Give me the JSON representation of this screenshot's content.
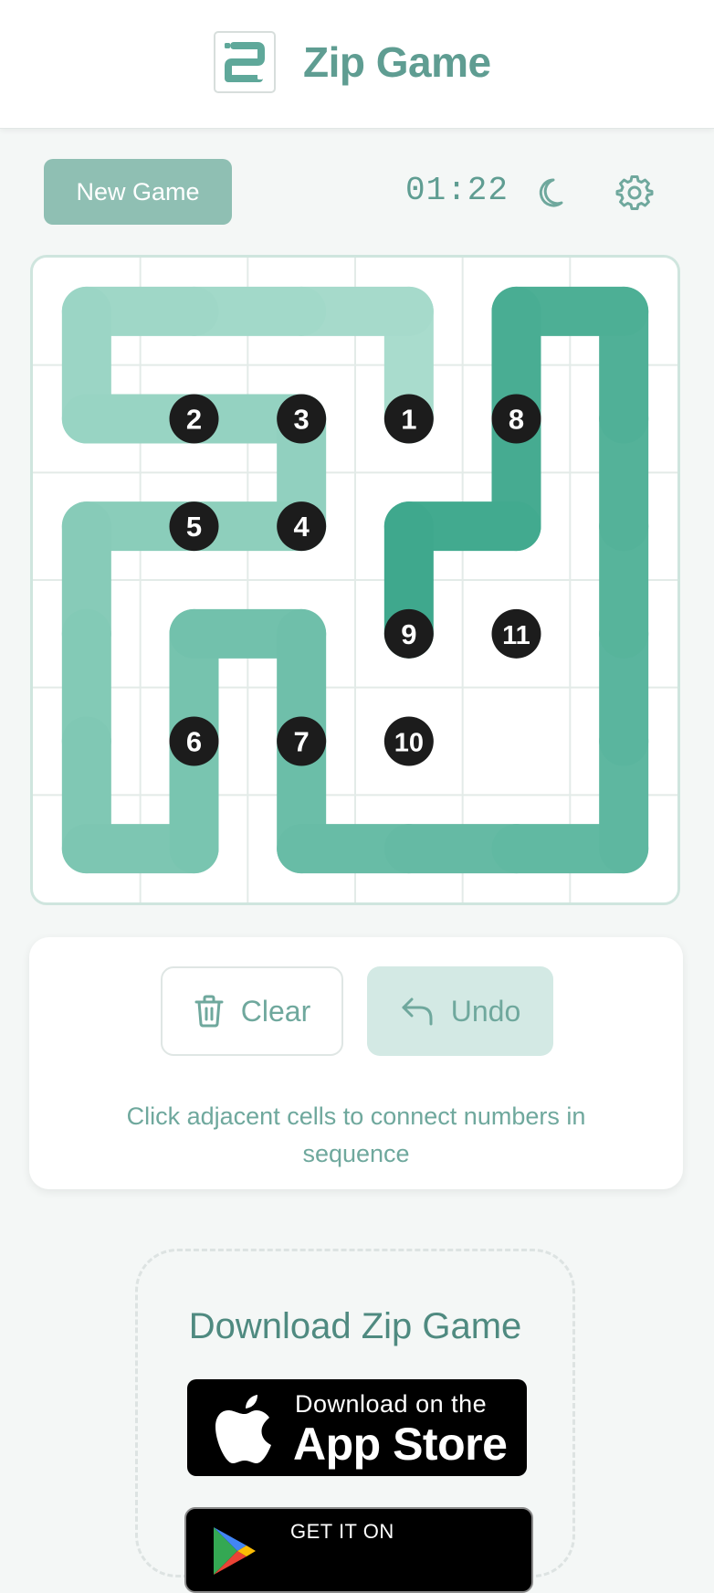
{
  "header": {
    "title": "Zip Game",
    "logo_icon": "zip-logo-icon"
  },
  "toolbar": {
    "new_game_label": "New Game",
    "timer": "01:22",
    "theme_icon": "moon-icon",
    "settings_icon": "gear-icon"
  },
  "board": {
    "rows": 6,
    "cols": 6,
    "numbers": [
      {
        "label": "1",
        "row": 1,
        "col": 3
      },
      {
        "label": "2",
        "row": 1,
        "col": 1
      },
      {
        "label": "3",
        "row": 1,
        "col": 2
      },
      {
        "label": "4",
        "row": 2,
        "col": 2
      },
      {
        "label": "5",
        "row": 2,
        "col": 1
      },
      {
        "label": "6",
        "row": 4,
        "col": 1
      },
      {
        "label": "7",
        "row": 4,
        "col": 2
      },
      {
        "label": "8",
        "row": 1,
        "col": 4
      },
      {
        "label": "9",
        "row": 3,
        "col": 3
      },
      {
        "label": "10",
        "row": 4,
        "col": 3
      },
      {
        "label": "11",
        "row": 3,
        "col": 4
      }
    ],
    "path": [
      [
        1,
        3
      ],
      [
        0,
        3
      ],
      [
        0,
        2
      ],
      [
        0,
        1
      ],
      [
        0,
        0
      ],
      [
        1,
        0
      ],
      [
        1,
        1
      ],
      [
        1,
        2
      ],
      [
        2,
        2
      ],
      [
        2,
        1
      ],
      [
        2,
        0
      ],
      [
        3,
        0
      ],
      [
        4,
        0
      ],
      [
        5,
        0
      ],
      [
        5,
        1
      ],
      [
        4,
        1
      ],
      [
        3,
        1
      ],
      [
        3,
        2
      ],
      [
        4,
        2
      ],
      [
        5,
        2
      ],
      [
        5,
        3
      ],
      [
        5,
        4
      ],
      [
        5,
        5
      ],
      [
        4,
        5
      ],
      [
        3,
        5
      ],
      [
        2,
        5
      ],
      [
        1,
        5
      ],
      [
        0,
        5
      ],
      [
        0,
        4
      ],
      [
        1,
        4
      ],
      [
        2,
        4
      ],
      [
        2,
        3
      ],
      [
        3,
        3
      ]
    ],
    "colors": {
      "path_start": "#a9dccd",
      "path_end": "#3fa88d",
      "number_fill": "#1c1c1c",
      "number_text": "#ffffff",
      "grid": "#e3ebe8"
    }
  },
  "controls": {
    "clear_label": "Clear",
    "clear_icon": "trash-icon",
    "undo_label": "Undo",
    "undo_icon": "undo-arrow-icon",
    "hint": "Click adjacent cells to connect numbers in sequence"
  },
  "download": {
    "title": "Download Zip Game",
    "appstore_small": "Download on the",
    "appstore_big": "App Store",
    "googleplay_small": "GET IT ON"
  },
  "accent": "#5f9d92"
}
